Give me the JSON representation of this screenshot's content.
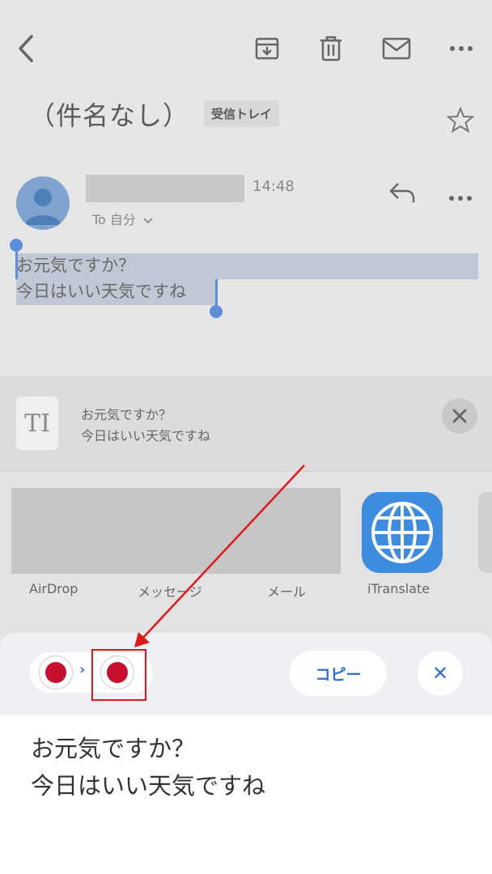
{
  "toolbar": {
    "back_icon": "chevron-left-icon",
    "archive_icon": "archive-icon",
    "delete_icon": "trash-icon",
    "mark_unread_icon": "envelope-icon",
    "more_icon": "more-horizontal-icon"
  },
  "email": {
    "subject": "（件名なし）",
    "label": "受信トレイ",
    "time": "14:48",
    "to": "To 自分",
    "body_line1": "お元気ですか？",
    "body_line2": "今日はいい天気ですね"
  },
  "share_sheet": {
    "preview_line1": "お元気ですか？",
    "preview_line2": "今日はいい天気ですね",
    "preview_icon": "TI",
    "apps": [
      {
        "label": "AirDrop"
      },
      {
        "label": "メッセージ"
      },
      {
        "label": "メール"
      },
      {
        "label": "iTranslate"
      }
    ]
  },
  "translate_panel": {
    "copy_label": "コピー",
    "close_label": "✕",
    "source_lang": "Japan",
    "target_lang": "Japan",
    "result_line1": "お元気ですか？",
    "result_line2": "今日はいい天気ですね"
  },
  "colors": {
    "accent": "#2f6fcf",
    "flag_red": "#c8102e",
    "annotation_red": "#e01818",
    "itranslate_blue": "#3e8ce0"
  }
}
